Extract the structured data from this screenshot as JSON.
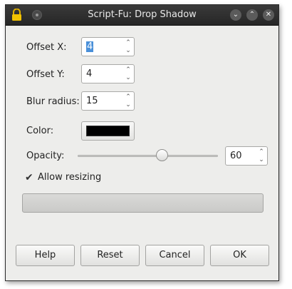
{
  "window": {
    "title": "Script-Fu: Drop Shadow"
  },
  "fields": {
    "offset_x": {
      "label": "Offset X:",
      "value": "4"
    },
    "offset_y": {
      "label": "Offset Y:",
      "value": "4"
    },
    "blur_radius": {
      "label": "Blur radius:",
      "value": "15"
    },
    "color": {
      "label": "Color:",
      "value": "#000000"
    },
    "opacity": {
      "label": "Opacity:",
      "value": "60",
      "slider_fraction": 0.6
    }
  },
  "allow_resizing": {
    "label": "Allow resizing",
    "checked": true,
    "mark": "✔"
  },
  "buttons": {
    "help": "Help",
    "reset": "Reset",
    "cancel": "Cancel",
    "ok": "OK"
  },
  "icons": {
    "spin_up": "⌃",
    "spin_down": "⌄",
    "minimize": "⌄",
    "maximize": "⌃",
    "close": "✕"
  }
}
